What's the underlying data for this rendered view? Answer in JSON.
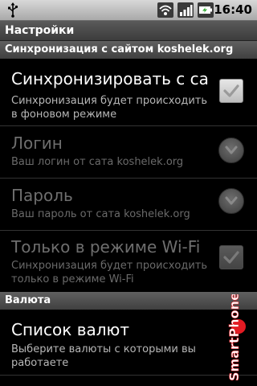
{
  "status_bar": {
    "time": "16:40",
    "icons": [
      "usb-icon",
      "wifi-icon",
      "signal-icon",
      "battery-icon"
    ]
  },
  "title": "Настройки",
  "sections": [
    {
      "header": "Синхронизация с сайтом koshelek.org",
      "items": [
        {
          "title": "Синхронизировать с са",
          "summary": "Синхронизация будет происходить в фоновом режиме",
          "enabled": true,
          "widget": "checkbox",
          "checked": true
        },
        {
          "title": "Логин",
          "summary": "Ваш логин от сата koshelek.org",
          "enabled": false,
          "widget": "round-indicator"
        },
        {
          "title": "Пароль",
          "summary": "Ваш пароль от сата koshelek.org",
          "enabled": false,
          "widget": "round-indicator"
        },
        {
          "title": "Только в режиме Wi-Fi",
          "summary": "Синхронизация будет происходить только в режиме Wi-Fi",
          "enabled": false,
          "widget": "checkbox",
          "checked": true
        }
      ]
    },
    {
      "header": "Валюта",
      "items": [
        {
          "title": "Список валют",
          "summary": "Выберите валюты с которыми вы работаете",
          "enabled": true,
          "widget": "none"
        }
      ]
    }
  ],
  "watermark": {
    "text": "SmartPhone"
  },
  "colors": {
    "background": "#000000",
    "header_bg": "#4a4a4a",
    "disabled_text": "#6e6e6e",
    "watermark_red": "#e31b23"
  }
}
